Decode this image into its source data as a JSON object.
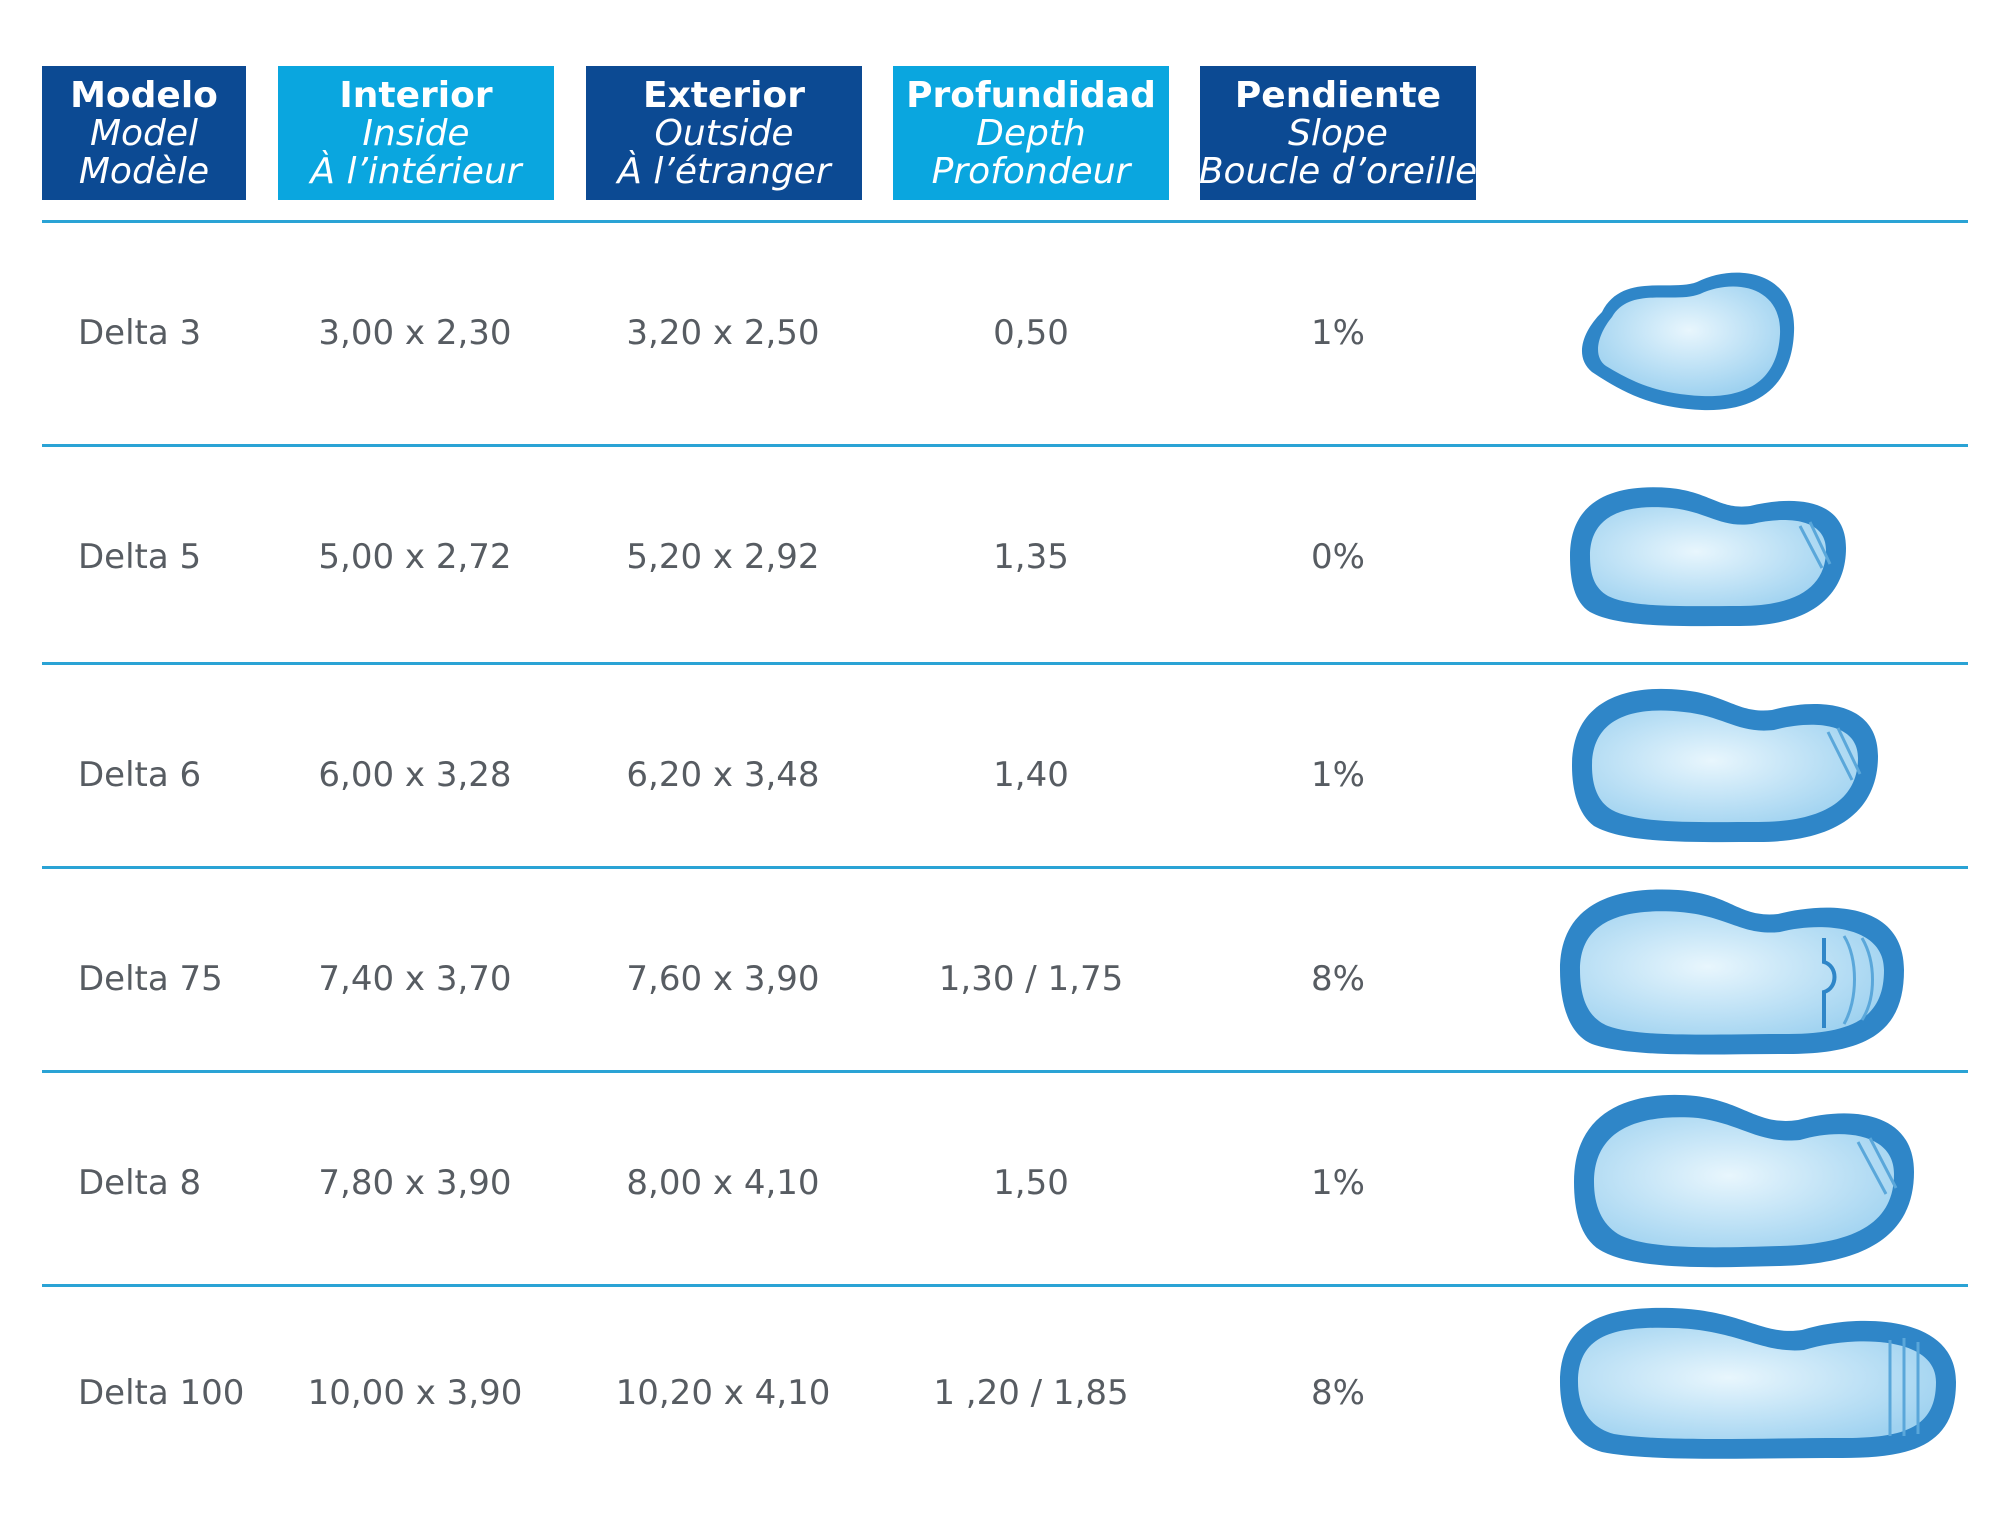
{
  "header": {
    "model": {
      "es": "Modelo",
      "en": "Model",
      "fr": "Modèle"
    },
    "inside": {
      "es": "Interior",
      "en": "Inside",
      "fr": "À l’intérieur"
    },
    "outside": {
      "es": "Exterior",
      "en": "Outside",
      "fr": "À l’étranger"
    },
    "depth": {
      "es": "Profundidad",
      "en": "Depth",
      "fr": "Profondeur"
    },
    "slope": {
      "es": "Pendiente",
      "en": "Slope",
      "fr": "Boucle d’oreille"
    }
  },
  "colors": {
    "header_dark": "#0c4a93",
    "header_light": "#0aa6df",
    "rule": "#2aa3d5",
    "text": "#575c62",
    "pool_edge": "#2f86c8",
    "pool_water": "#bfe3f7"
  },
  "rows": [
    {
      "model": "Delta 3",
      "inside": "3,00 x 2,30",
      "outside": "3,20 x 2,50",
      "depth": "0,50",
      "slope": "1%",
      "image": "kidney-pool-small"
    },
    {
      "model": "Delta 5",
      "inside": "5,00 x 2,72",
      "outside": "5,20 x 2,92",
      "depth": "1,35",
      "slope": "0%",
      "image": "kidney-pool-steps"
    },
    {
      "model": "Delta 6",
      "inside": "6,00 x 3,28",
      "outside": "6,20 x 3,48",
      "depth": "1,40",
      "slope": "1%",
      "image": "kidney-pool-steps"
    },
    {
      "model": "Delta 75",
      "inside": "7,40 x 3,70",
      "outside": "7,60 x 3,90",
      "depth": "1,30 / 1,75",
      "slope": "8%",
      "image": "kidney-pool-curved-steps"
    },
    {
      "model": "Delta 8",
      "inside": "7,80 x 3,90",
      "outside": "8,00 x 4,10",
      "depth": "1,50",
      "slope": "1%",
      "image": "kidney-pool-steps"
    },
    {
      "model": "Delta 100",
      "inside": "10,00 x 3,90",
      "outside": "10,20 x 4,10",
      "depth": "1 ,20 / 1,85",
      "slope": "8%",
      "image": "kidney-pool-long"
    }
  ]
}
